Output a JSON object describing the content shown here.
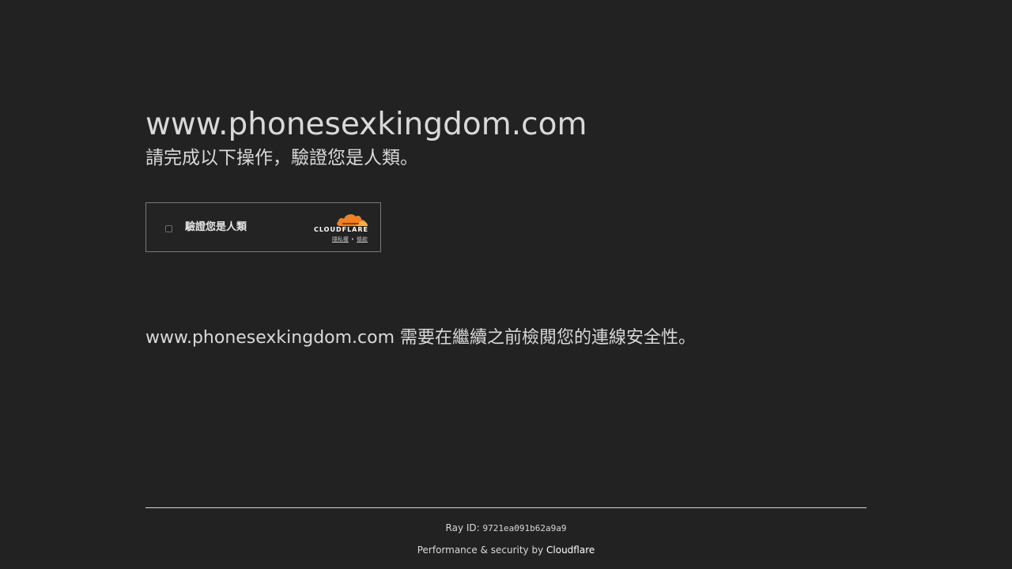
{
  "page": {
    "site_title": "www.phonesexkingdom.com",
    "subtitle": "請完成以下操作，驗證您是人類。",
    "description": "www.phonesexkingdom.com 需要在繼續之前檢閱您的連線安全性。"
  },
  "widget": {
    "checkbox_label": "驗證您是人類",
    "brand_wordmark": "CLOUDFLARE",
    "privacy_link": "隱私權",
    "separator": "•",
    "terms_link": "條款",
    "brand_color": "#f38020",
    "brand_color_light": "#faae40"
  },
  "footer": {
    "ray_label": "Ray ID: ",
    "ray_id": "9721ea091b62a9a9",
    "perf_label": "Performance & security by ",
    "perf_brand": "Cloudflare"
  }
}
